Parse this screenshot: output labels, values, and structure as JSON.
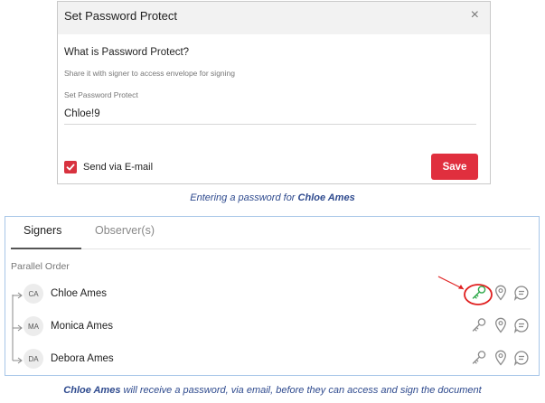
{
  "modal": {
    "title": "Set Password Protect",
    "close_glyph": "×",
    "question": "What is Password Protect?",
    "description": "Share it with signer to access envelope for signing",
    "field_label": "Set Password Protect",
    "field_value": "Chloe!9",
    "checkbox_label": "Send via E-mail",
    "checkbox_checked": true,
    "save_label": "Save",
    "accent_color": "#e02f3e"
  },
  "caption1": {
    "prefix": "Entering a password for ",
    "name": "Chloe Ames"
  },
  "panel": {
    "tabs": [
      {
        "label": "Signers",
        "active": true
      },
      {
        "label": "Observer(s)",
        "active": false
      }
    ],
    "order_label": "Parallel Order",
    "signers": [
      {
        "initials": "CA",
        "name": "Chloe Ames",
        "password_set": true
      },
      {
        "initials": "MA",
        "name": "Monica Ames",
        "password_set": false
      },
      {
        "initials": "DA",
        "name": "Debora Ames",
        "password_set": false
      }
    ],
    "icons": [
      "key-icon",
      "location-pin-icon",
      "comment-icon"
    ]
  },
  "caption2": {
    "name": "Chloe Ames",
    "rest": " will receive a password, via email, before they can access and sign the document"
  }
}
